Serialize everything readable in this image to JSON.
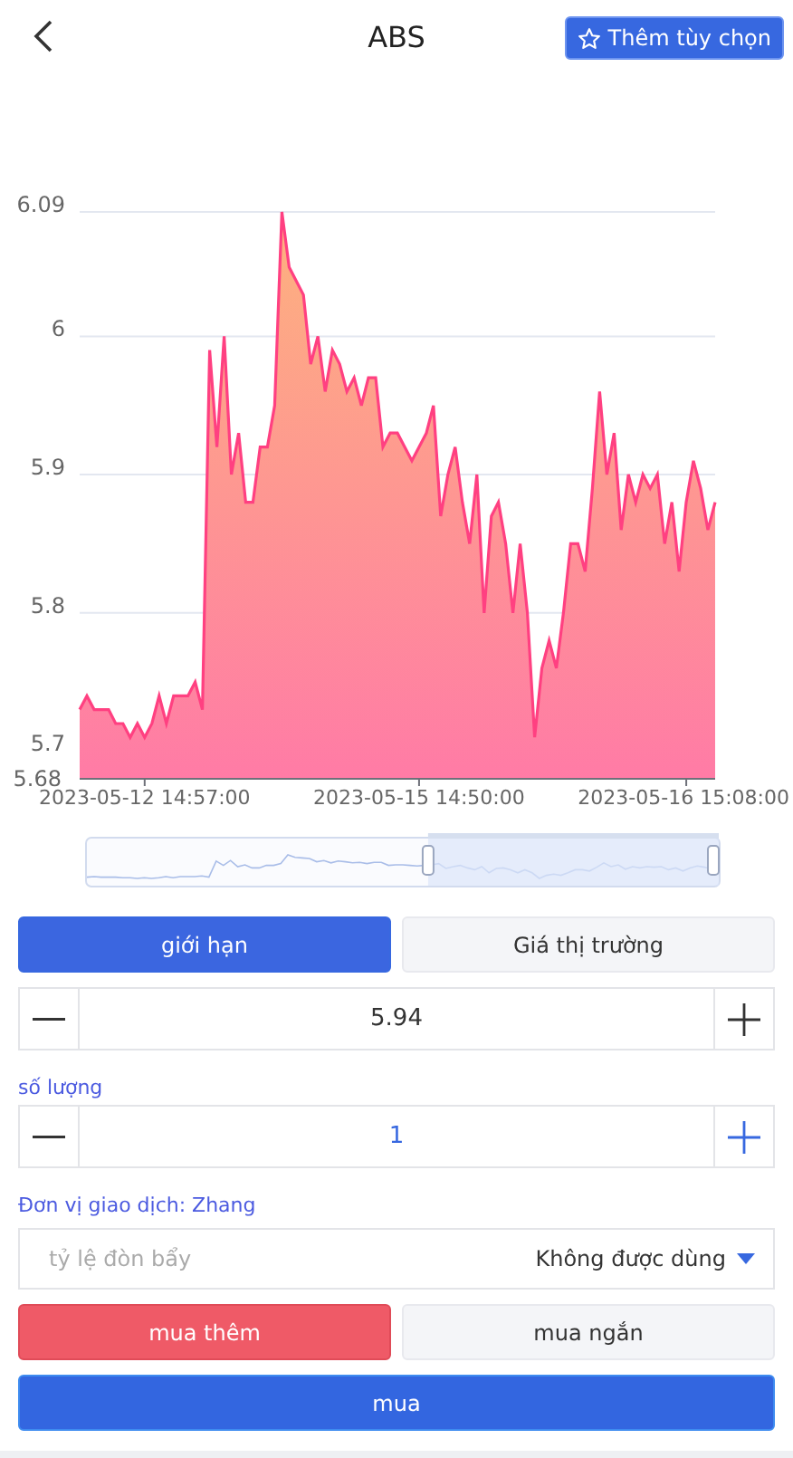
{
  "header": {
    "title": "ABS",
    "favorite_button": "Thêm tùy chọn"
  },
  "chart": {
    "chart_data": {
      "type": "area",
      "grid": true,
      "ylim": [
        5.68,
        6.09
      ],
      "yticks": [
        5.68,
        5.7,
        5.8,
        5.9,
        6,
        6.09
      ],
      "categories": [
        null,
        null,
        null,
        null,
        null,
        null,
        null,
        null,
        null,
        "2023-05-12 14:57:00",
        null,
        null,
        null,
        null,
        null,
        null,
        null,
        null,
        null,
        null,
        null,
        null,
        null,
        null,
        null,
        null,
        null,
        null,
        null,
        null,
        null,
        null,
        null,
        null,
        null,
        null,
        null,
        null,
        null,
        null,
        null,
        null,
        null,
        null,
        null,
        null,
        null,
        "2023-05-15 14:50:00",
        null,
        null,
        null,
        null,
        null,
        null,
        null,
        null,
        null,
        null,
        null,
        null,
        null,
        null,
        null,
        null,
        null,
        null,
        null,
        null,
        null,
        null,
        null,
        null,
        null,
        null,
        null,
        null,
        null,
        null,
        null,
        null,
        null,
        null,
        null,
        null,
        "2023-05-16 15:08:00",
        null,
        null,
        null,
        null
      ],
      "series": [
        {
          "color": "#ff4081",
          "values": [
            5.73,
            5.74,
            5.73,
            5.73,
            5.73,
            5.72,
            5.72,
            5.71,
            5.72,
            5.71,
            5.72,
            5.74,
            5.72,
            5.74,
            5.74,
            5.74,
            5.75,
            5.73,
            5.99,
            5.92,
            6.0,
            5.9,
            5.93,
            5.88,
            5.88,
            5.92,
            5.92,
            5.95,
            6.09,
            6.05,
            6.04,
            6.03,
            5.98,
            6.0,
            5.96,
            5.99,
            5.98,
            5.96,
            5.97,
            5.95,
            5.97,
            5.97,
            5.92,
            5.93,
            5.93,
            5.92,
            5.91,
            5.92,
            5.93,
            5.95,
            5.87,
            5.9,
            5.92,
            5.88,
            5.85,
            5.9,
            5.8,
            5.87,
            5.88,
            5.85,
            5.8,
            5.85,
            5.8,
            5.71,
            5.76,
            5.78,
            5.76,
            5.8,
            5.85,
            5.85,
            5.83,
            5.89,
            5.96,
            5.9,
            5.93,
            5.86,
            5.9,
            5.88,
            5.9,
            5.89,
            5.9,
            5.85,
            5.88,
            5.83,
            5.88,
            5.91,
            5.89,
            5.86,
            5.88
          ]
        }
      ]
    }
  },
  "zoom_slider": {
    "level": 0.46
  },
  "order_types": [
    {
      "label": "giới hạn",
      "selected": true
    },
    {
      "label": "Giá thị trường",
      "selected": false
    }
  ],
  "price": {
    "value": "5.94"
  },
  "quantity": {
    "label": "số lượng",
    "value": "1"
  },
  "trade_unit": "Đơn vị giao dịch: Zhang",
  "leverage": {
    "placeholder": "tỷ lệ đòn bẩy",
    "value": "Không được dùng"
  },
  "directions": [
    {
      "label": "mua thêm",
      "selected": true
    },
    {
      "label": "mua ngắn",
      "selected": false
    }
  ],
  "submit": "mua"
}
